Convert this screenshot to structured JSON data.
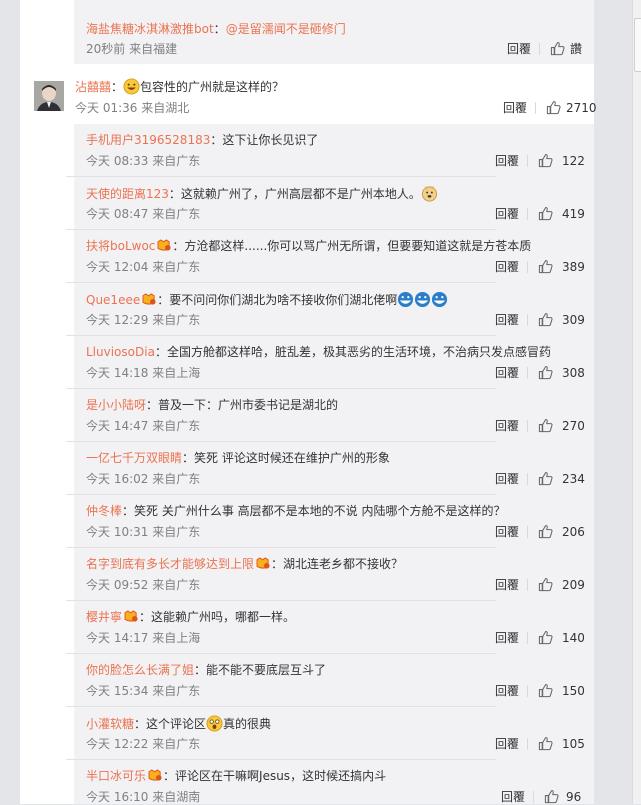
{
  "top_reply": {
    "user": "海盐焦糖冰淇淋激推bot",
    "sep": "：",
    "text": "@是留濡闻不是砸修门",
    "meta": "20秒前 来自福建",
    "reply_label": "回覆",
    "like_label": "讚"
  },
  "main_comment": {
    "user": "沾囍囍",
    "sep": "：",
    "text": "包容性的广州就是这样的？",
    "meta": "今天 01:36 来自湖北",
    "reply_label": "回覆",
    "likes": "2710"
  },
  "replies": [
    {
      "user": "手机用户3196528183",
      "sep": "：",
      "text": "这下让你长见识了",
      "meta": "今天 08:33 来自广东",
      "reply_label": "回覆",
      "likes": "122"
    },
    {
      "user": "天使的距离123",
      "sep": "：",
      "text": "这就赖广州了，广州高层都不是广州本地人。",
      "meta": "今天 08:47 来自广东",
      "reply_label": "回覆",
      "likes": "419"
    },
    {
      "user": "扶将boLwoc",
      "sep": "：",
      "text": "方沧都这样......你可以骂广州无所谓，但要要知道这就是方苍本质",
      "meta": "今天 12:04 来自广东",
      "reply_label": "回覆",
      "likes": "389"
    },
    {
      "user": "Que1eee",
      "sep": "：",
      "text": "要不问问你们湖北为啥不接收你们湖北佬啊",
      "meta": "今天 12:29 来自广东",
      "reply_label": "回覆",
      "likes": "309"
    },
    {
      "user": "LluviosoDia",
      "sep": "：",
      "text": "全国方舱都这样哈，脏乱差，极其恶劣的生活环境，不治病只发点感冒药",
      "meta": "今天 14:18 来自上海",
      "reply_label": "回覆",
      "likes": "308"
    },
    {
      "user": "是小小陆呀",
      "sep": "：",
      "text": "普及一下：广州市委书记是湖北的",
      "meta": "今天 14:47 来自广东",
      "reply_label": "回覆",
      "likes": "270"
    },
    {
      "user": "一亿七千万双眼睛",
      "sep": "：",
      "text": "笑死 评论这时候还在维护广州的形象",
      "meta": "今天 16:02 来自广东",
      "reply_label": "回覆",
      "likes": "234"
    },
    {
      "user": "仲冬棒",
      "sep": "：",
      "text": "笑死 关广州什么事 高层都不是本地的不说 内陆哪个方舱不是这样的？",
      "meta": "今天 10:31 来自广东",
      "reply_label": "回覆",
      "likes": "206"
    },
    {
      "user": "名字到底有多长才能够达到上限",
      "sep": "：",
      "text": "湖北连老乡都不接收？",
      "meta": "今天 09:52 来自广东",
      "reply_label": "回覆",
      "likes": "209"
    },
    {
      "user": "樱井寧",
      "sep": "：",
      "text": "这能赖广州吗，哪都一样。",
      "meta": "今天 14:17 来自上海",
      "reply_label": "回覆",
      "likes": "140"
    },
    {
      "user": "你的脸怎么长满了姐",
      "sep": "：",
      "text": "能不能不要底层互斗了",
      "meta": "今天 15:34 来自广东",
      "reply_label": "回覆",
      "likes": "150"
    },
    {
      "user": "小灌软糖",
      "sep": "：",
      "text": "这个评论区",
      "text2": "真的很典",
      "meta": "今天 12:22 来自广东",
      "reply_label": "回覆",
      "likes": "105"
    },
    {
      "user": "半口冰可乐",
      "sep": "：",
      "text": "评论区在干嘛啊Jesus，这时候还搞内斗",
      "meta": "今天 16:10 来自湖南",
      "reply_label": "回覆",
      "likes": "96"
    }
  ],
  "colors": {
    "username": "#eb7350",
    "meta": "#808080",
    "reply_bg": "#f2f2f5",
    "page_bg": "#e4e5e8"
  },
  "icons": {
    "like": "thumbs-up-icon",
    "badge": "fan-badge-icon",
    "emoji": "emoji-icon"
  }
}
